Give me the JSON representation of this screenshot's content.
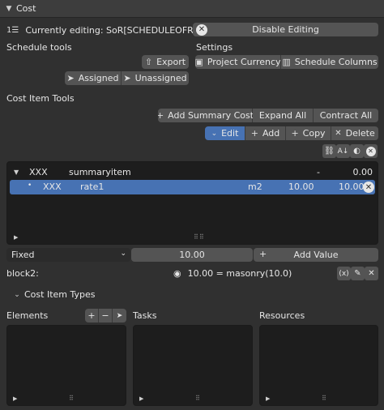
{
  "header": {
    "title": "Cost"
  },
  "editing": {
    "label": "Currently editing: SoR[SCHEDULEOFRATES]",
    "disable_button": "Disable Editing"
  },
  "schedule_tools": {
    "heading": "Schedule tools",
    "export": "Export",
    "assigned": "Assigned",
    "unassigned": "Unassigned"
  },
  "settings": {
    "heading": "Settings",
    "project_currency": "Project Currency",
    "schedule_columns": "Schedule Columns"
  },
  "cost_item_tools": {
    "heading": "Cost Item Tools",
    "add_summary_cost": "Add Summary Cost",
    "expand_all": "Expand All",
    "contract_all": "Contract All",
    "edit": "Edit",
    "add": "Add",
    "copy": "Copy",
    "delete": "Delete"
  },
  "tree": {
    "rows": [
      {
        "code": "XXX",
        "name": "summaryitem",
        "unit": "-",
        "qty": "",
        "value": "0.00",
        "selected": false
      },
      {
        "code": "XXX",
        "name": "rate1",
        "unit": "m2",
        "qty": "10.00",
        "value": "10.00",
        "selected": true
      }
    ]
  },
  "value_bar": {
    "type": "Fixed",
    "value": "10.00",
    "add_value": "Add Value"
  },
  "block": {
    "label": "block2:",
    "formula": "10.00 = masonry(10.0)"
  },
  "cost_item_types": {
    "title": "Cost Item Types",
    "elements": "Elements",
    "tasks": "Tasks",
    "resources": "Resources"
  }
}
